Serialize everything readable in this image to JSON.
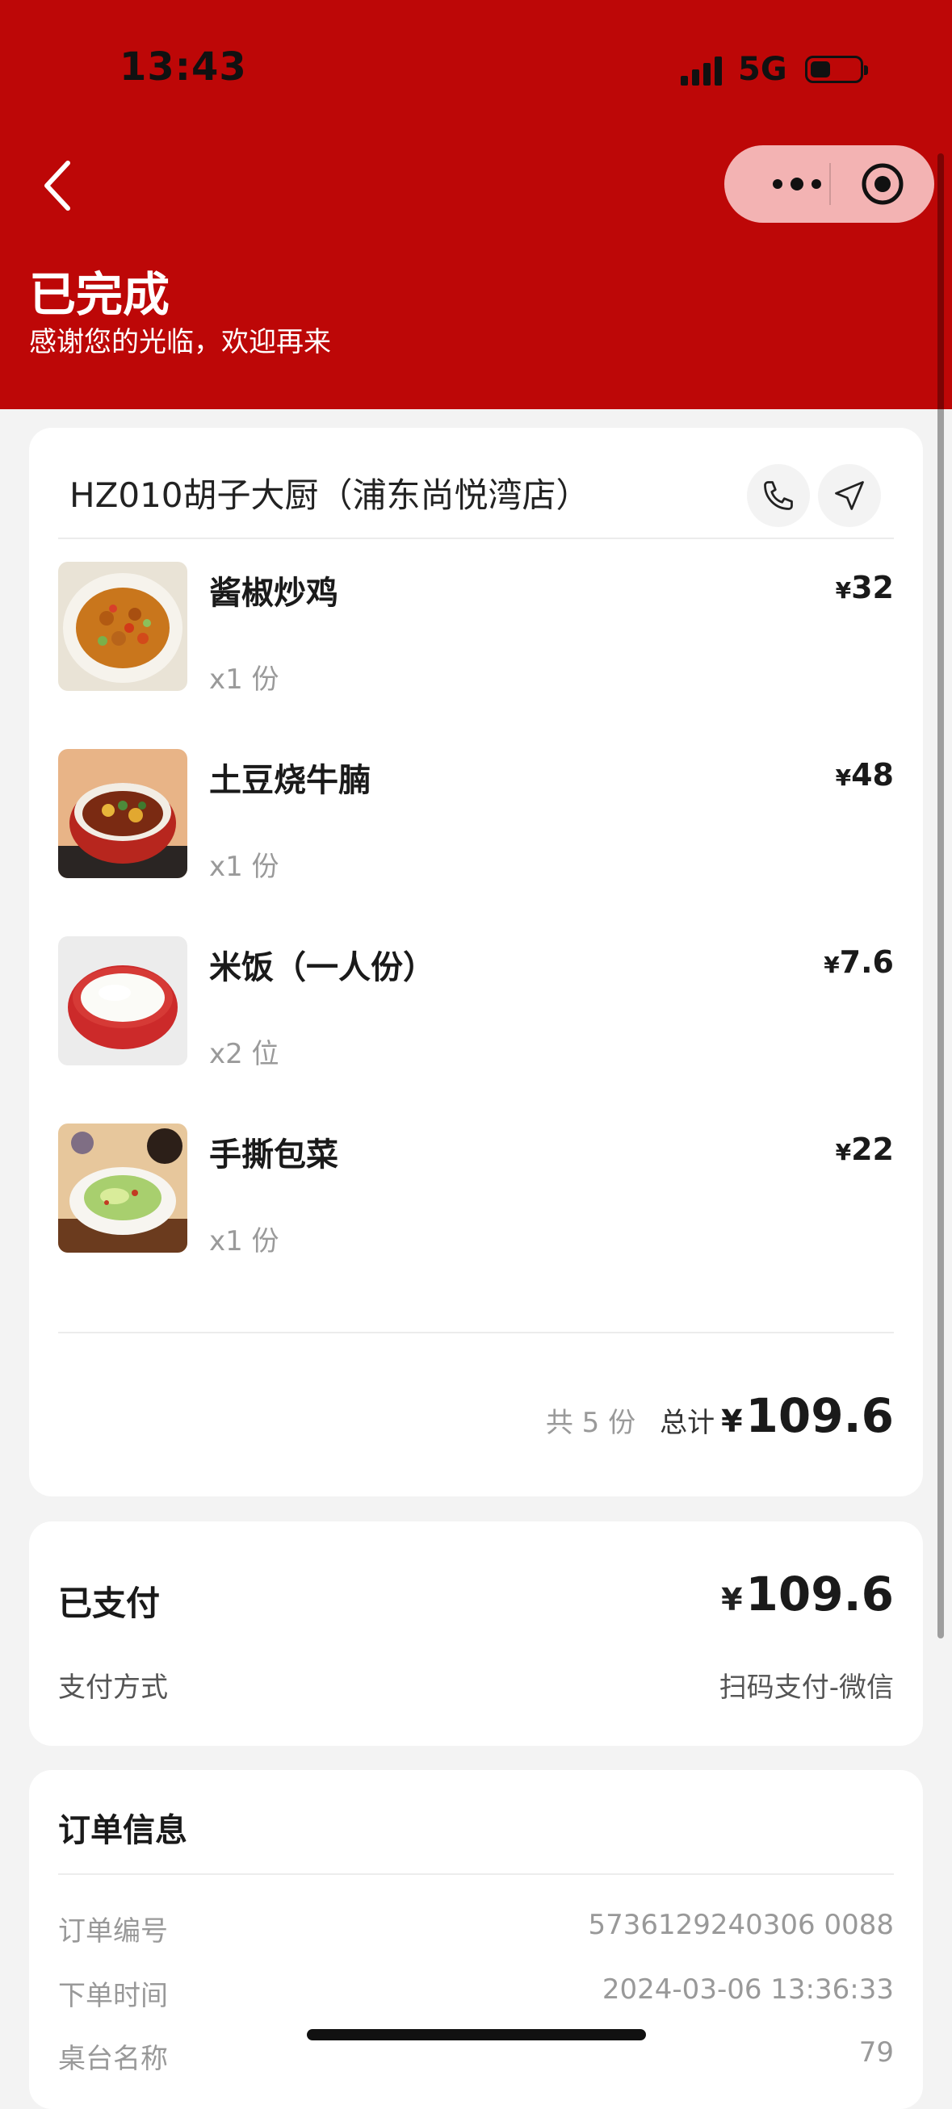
{
  "status_bar": {
    "time": "13:43",
    "network": "5G"
  },
  "header": {
    "title": "已完成",
    "subtitle": "感谢您的光临，欢迎再来"
  },
  "store": {
    "name": "HZ010胡子大厨（浦东尚悦湾店）"
  },
  "items": [
    {
      "name": "酱椒炒鸡",
      "qty": "x1 份",
      "price": "32"
    },
    {
      "name": "土豆烧牛腩",
      "qty": "x1 份",
      "price": "48"
    },
    {
      "name": "米饭（一人份）",
      "qty": "x2 位",
      "price": "7.6"
    },
    {
      "name": "手撕包菜",
      "qty": "x1 份",
      "price": "22"
    }
  ],
  "currency": "¥",
  "summary": {
    "count": "共 5 份",
    "total_label": "总计",
    "total": "109.6"
  },
  "payment": {
    "paid_label": "已支付",
    "paid_amount": "109.6",
    "method_label": "支付方式",
    "method_value": "扫码支付-微信"
  },
  "order": {
    "title": "订单信息",
    "rows": [
      {
        "label": "订单编号",
        "value": "5736129240306 0088"
      },
      {
        "label": "下单时间",
        "value": "2024-03-06 13:36:33"
      },
      {
        "label": "桌台名称",
        "value": "79"
      }
    ]
  },
  "colors": {
    "header_red": "#bd0707",
    "page_bg": "#f3f3f3"
  }
}
